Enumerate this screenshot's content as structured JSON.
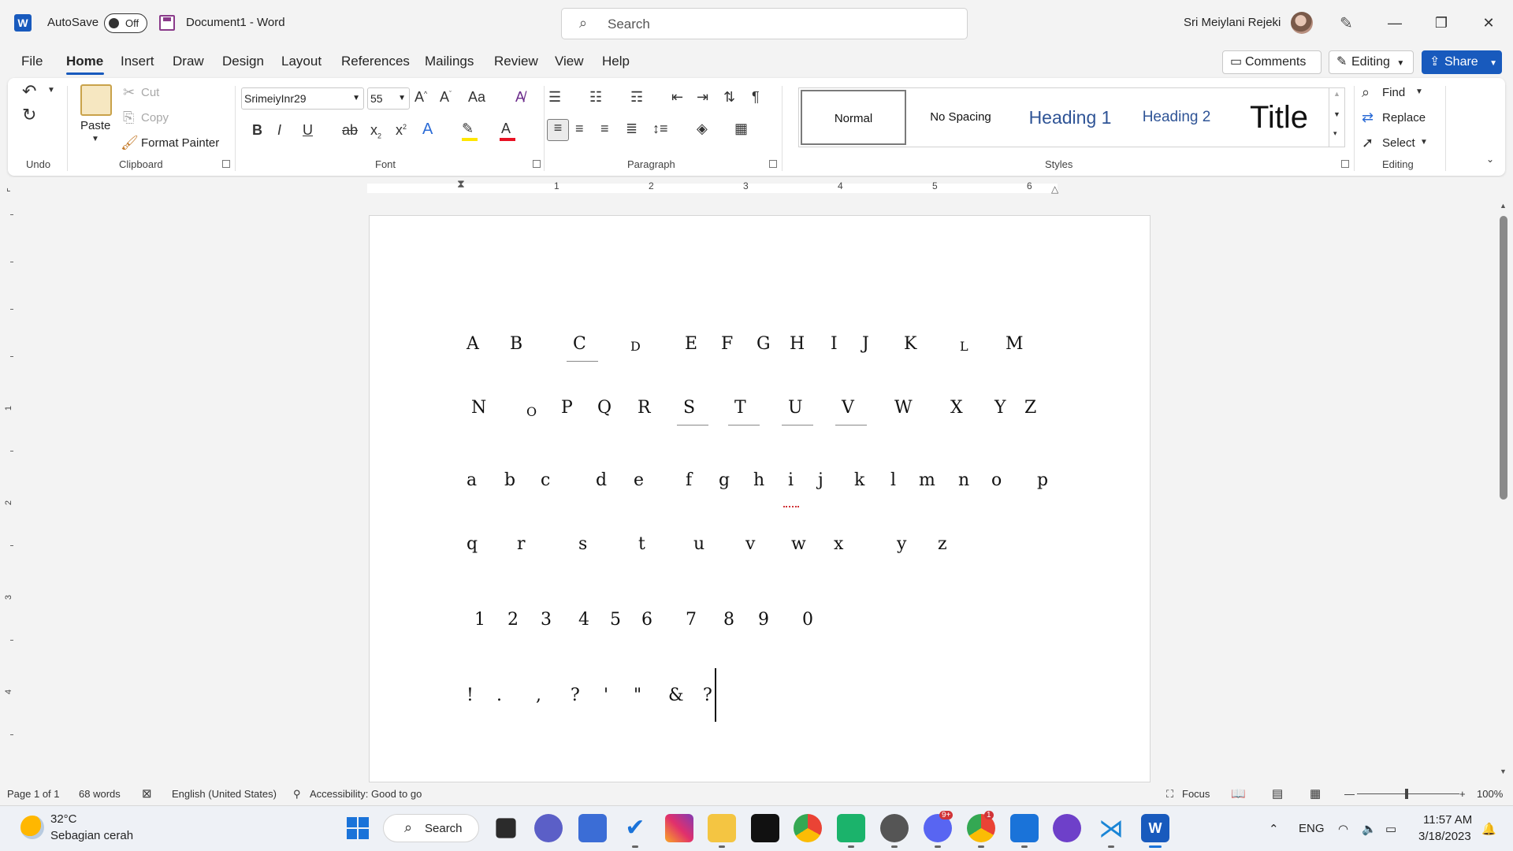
{
  "titlebar": {
    "autosave_label": "AutoSave",
    "autosave_state": "Off",
    "doc_title": "Document1  -  Word",
    "search_placeholder": "Search",
    "user_name": "Sri Meiylani Rejeki"
  },
  "tabs": [
    "File",
    "Home",
    "Insert",
    "Draw",
    "Design",
    "Layout",
    "References",
    "Mailings",
    "Review",
    "View",
    "Help"
  ],
  "active_tab": "Home",
  "top_buttons": {
    "comments": "Comments",
    "editing": "Editing",
    "share": "Share"
  },
  "ribbon": {
    "undo_group": "Undo",
    "clipboard": {
      "paste": "Paste",
      "cut": "Cut",
      "copy": "Copy",
      "format_painter": "Format Painter",
      "label": "Clipboard"
    },
    "font": {
      "name": "SrimeiyInr29",
      "size": "55",
      "label": "Font"
    },
    "paragraph_label": "Paragraph",
    "styles": {
      "items": [
        "Normal",
        "No Spacing",
        "Heading 1",
        "Heading 2",
        "Title"
      ],
      "label": "Styles"
    },
    "editing": {
      "find": "Find",
      "replace": "Replace",
      "select": "Select",
      "label": "Editing"
    }
  },
  "ruler_numbers": [
    "1",
    "2",
    "3",
    "4",
    "5",
    "6"
  ],
  "vruler_numbers": [
    "1",
    "2",
    "3",
    "4"
  ],
  "document": {
    "rows": [
      [
        "A",
        "B",
        "C",
        "D",
        "E",
        "F",
        "G",
        "H",
        "I",
        "J",
        "K",
        "L",
        "M"
      ],
      [
        "N",
        "O",
        "P",
        "Q",
        "R",
        "S",
        "T",
        "U",
        "V",
        "W",
        "X",
        "Y",
        "Z"
      ],
      [
        "a",
        "b",
        "c",
        "d",
        "e",
        "f",
        "g",
        "h",
        "i",
        "j",
        "k",
        "l",
        "m",
        "n",
        "o",
        "p"
      ],
      [
        "q",
        "r",
        "s",
        "t",
        "u",
        "v",
        "w",
        "x",
        "y",
        "z"
      ],
      [
        "1",
        "2",
        "3",
        "4",
        "5",
        "6",
        "7",
        "8",
        "9",
        "0"
      ],
      [
        "!",
        ".",
        ",",
        "?",
        "'",
        "\"",
        "&",
        "?"
      ]
    ]
  },
  "status": {
    "page": "Page 1 of 1",
    "words": "68 words",
    "language": "English (United States)",
    "accessibility": "Accessibility: Good to go",
    "focus": "Focus",
    "zoom": "100%"
  },
  "taskbar": {
    "weather_temp": "32°C",
    "weather_desc": "Sebagian cerah",
    "search": "Search",
    "lang": "ENG",
    "time": "11:57 AM",
    "date": "3/18/2023",
    "discord_badge": "9+",
    "chrome_badge": "1"
  },
  "colors": {
    "accent": "#185abd",
    "red": "#d13438"
  }
}
